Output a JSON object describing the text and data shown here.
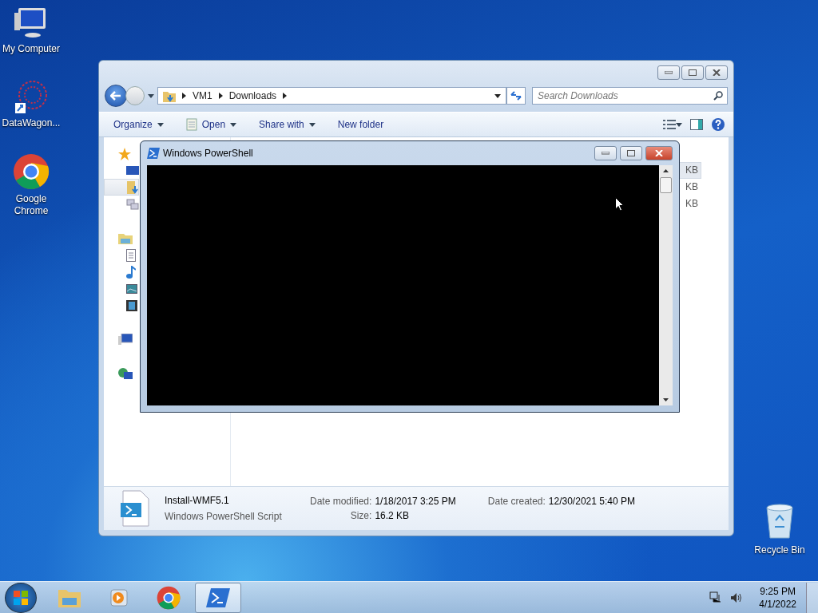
{
  "desktop_icons": [
    {
      "kind": "computer",
      "label": "My Computer"
    },
    {
      "kind": "shortcut",
      "label": "DataWagon..."
    },
    {
      "kind": "chrome",
      "label": "Google Chrome"
    }
  ],
  "recycle_bin": {
    "label": "Recycle Bin"
  },
  "explorer": {
    "breadcrumb": [
      "VM1",
      "Downloads"
    ],
    "search": {
      "placeholder": "Search Downloads"
    },
    "toolbar": [
      {
        "label": "Organize",
        "dropdown": true,
        "icon": false
      },
      {
        "label": "Open",
        "dropdown": true,
        "icon": true
      },
      {
        "label": "Share with",
        "dropdown": true,
        "icon": false
      },
      {
        "label": "New folder",
        "dropdown": false,
        "icon": false
      }
    ],
    "nav": [
      {
        "kind": "favorites",
        "selected": false
      },
      {
        "kind": "desktop",
        "selected": false
      },
      {
        "kind": "downloads",
        "selected": true
      },
      {
        "kind": "recent",
        "selected": false
      },
      {
        "kind": "libraries",
        "selected": false
      },
      {
        "kind": "documents",
        "selected": false
      },
      {
        "kind": "music",
        "selected": false
      },
      {
        "kind": "pictures",
        "selected": false
      },
      {
        "kind": "videos",
        "selected": false
      },
      {
        "kind": "computer",
        "selected": false
      },
      {
        "kind": "network",
        "selected": false
      }
    ],
    "sizes": [
      {
        "text": "KB",
        "selected": true
      },
      {
        "text": "KB",
        "selected": false
      },
      {
        "text": "KB",
        "selected": false
      }
    ],
    "details": {
      "name": "Install-WMF5.1",
      "type": "Windows PowerShell Script",
      "fields": [
        {
          "label": "Date modified:",
          "value": "1/18/2017 3:25 PM"
        },
        {
          "label": "Size:",
          "value": "16.2 KB"
        },
        {
          "label": "Date created:",
          "value": "12/30/2021 5:40 PM"
        }
      ]
    }
  },
  "powershell": {
    "title": "Windows PowerShell"
  },
  "taskbar": {
    "items": [
      {
        "kind": "explorer",
        "active": false
      },
      {
        "kind": "media",
        "active": false
      },
      {
        "kind": "chrome",
        "active": false
      },
      {
        "kind": "powershell",
        "active": true
      }
    ],
    "time": "9:25 PM",
    "date": "4/1/2022"
  }
}
